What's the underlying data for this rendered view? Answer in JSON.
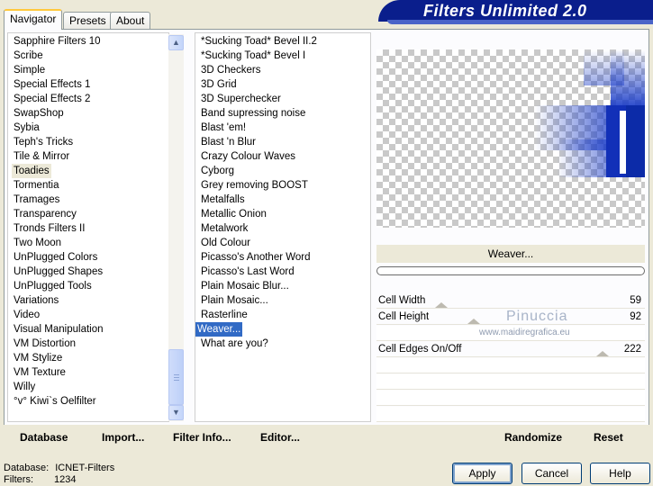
{
  "header": {
    "title": "Filters Unlimited 2.0"
  },
  "tabs": [
    "Navigator",
    "Presets",
    "About"
  ],
  "categories": [
    "Sapphire Filters 10",
    "Scribe",
    "Simple",
    "Special Effects 1",
    "Special Effects 2",
    "SwapShop",
    "Sybia",
    "Teph's Tricks",
    "Tile & Mirror",
    "Toadies",
    "Tormentia",
    "Tramages",
    "Transparency",
    "Tronds Filters II",
    "Two Moon",
    "UnPlugged Colors",
    "UnPlugged Shapes",
    "UnPlugged Tools",
    "Variations",
    "Video",
    "Visual Manipulation",
    "VM Distortion",
    "VM Stylize",
    "VM Texture",
    "Willy",
    "°v° Kiwi`s Oelfilter"
  ],
  "filters": [
    "*Sucking Toad*  Bevel II.2",
    "*Sucking Toad*  Bevel I",
    "3D Checkers",
    "3D Grid",
    "3D Superchecker",
    "Band supressing noise",
    "Blast 'em!",
    "Blast 'n Blur",
    "Crazy Colour Waves",
    "Cyborg",
    "Grey removing BOOST",
    "Metalfalls",
    "Metallic Onion",
    "Metalwork",
    "Old Colour",
    "Picasso's Another Word",
    "Picasso's Last Word",
    "Plain Mosaic Blur...",
    "Plain Mosaic...",
    "Rasterline",
    "Weaver...",
    "What are you?"
  ],
  "selected_category": "Toadies",
  "selected_filter": "Weaver...",
  "preview": {
    "filter_name": "Weaver..."
  },
  "params": [
    {
      "label": "Cell Width",
      "value": 59
    },
    {
      "label": "Cell Height",
      "value": 92
    },
    {
      "label": "Cell Edges On/Off",
      "value": 222
    }
  ],
  "watermark": {
    "name": "Pinuccia",
    "url": "www.maidiregrafica.eu"
  },
  "links": {
    "database": "Database",
    "import": "Import...",
    "filter_info": "Filter Info...",
    "editor": "Editor...",
    "randomize": "Randomize",
    "reset": "Reset"
  },
  "status": {
    "database_label": "Database:",
    "database_value": "ICNET-Filters",
    "filters_label": "Filters:",
    "filters_value": "1234"
  },
  "buttons": {
    "apply": "Apply",
    "cancel": "Cancel",
    "help": "Help"
  },
  "icons": {
    "scroll_up": "▲",
    "scroll_down": "▼"
  },
  "colors": {
    "selection_blue": "#316ac5",
    "banner": "#0a1e8c",
    "tab_accent": "#ffc83c"
  }
}
